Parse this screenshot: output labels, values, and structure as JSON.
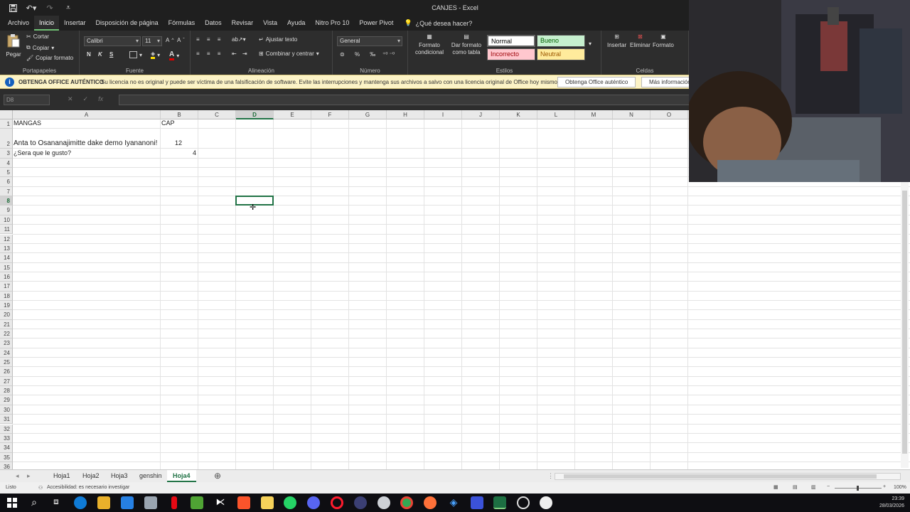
{
  "window": {
    "title": "CANJES - Excel"
  },
  "menu": {
    "tabs": [
      "Archivo",
      "Inicio",
      "Insertar",
      "Disposición de página",
      "Fórmulas",
      "Datos",
      "Revisar",
      "Vista",
      "Ayuda",
      "Nitro Pro 10",
      "Power Pivot"
    ],
    "tell_me": "¿Qué desea hacer?"
  },
  "ribbon": {
    "clipboard": {
      "paste": "Pegar",
      "cut": "Cortar",
      "copy": "Copiar",
      "format_painter": "Copiar formato",
      "label": "Portapapeles"
    },
    "font": {
      "name": "Calibri",
      "size": "11",
      "bold": "N",
      "italic": "K",
      "underline": "S",
      "label": "Fuente"
    },
    "alignment": {
      "wrap": "Ajustar texto",
      "merge": "Combinar y centrar",
      "label": "Alineación"
    },
    "number": {
      "format": "General",
      "label": "Número"
    },
    "styles": {
      "conditional": "Formato condicional",
      "as_table": "Dar formato como tabla",
      "normal": "Normal",
      "bueno": "Bueno",
      "incorrecto": "Incorrecto",
      "neutral": "Neutral",
      "label": "Estilos"
    },
    "cells": {
      "insert": "Insertar",
      "delete": "Eliminar",
      "format": "Formato",
      "label": "Celdas"
    }
  },
  "warning": {
    "title": "OBTENGA OFFICE AUTÉNTICO",
    "message": "Su licencia no es original y puede ser víctima de una falsificación de software. Evite las interrupciones y mantenga sus archivos a salvo con una licencia original de Office hoy mismo.",
    "button_primary": "Obtenga Office auténtico",
    "button_more": "Más información"
  },
  "formula_bar": {
    "name_box": "D8",
    "fx": "fx",
    "value": ""
  },
  "sheet": {
    "columns": [
      "A",
      "B",
      "C",
      "D",
      "E",
      "F",
      "G",
      "H",
      "I",
      "J",
      "K",
      "L",
      "M",
      "N",
      "O"
    ],
    "rows": [
      "1",
      "2",
      "3",
      "4",
      "5",
      "6",
      "7",
      "8",
      "9",
      "10",
      "11",
      "12",
      "13",
      "14",
      "15",
      "16",
      "17",
      "18",
      "19",
      "20",
      "21",
      "22",
      "23",
      "24",
      "25",
      "26",
      "27",
      "28",
      "29",
      "30",
      "31",
      "32",
      "33",
      "34",
      "35",
      "36"
    ],
    "cells": {
      "A1": "MANGAS",
      "B1": "CAP",
      "A2": "Anta to Osananajimitte dake demo Iyananoni!",
      "B2": "12",
      "A3": "¿Sera que le gusto?",
      "B3": "4"
    },
    "selected_cell": "D8"
  },
  "tabs": [
    "Hoja1",
    "Hoja2",
    "Hoja3",
    "genshin",
    "Hoja4"
  ],
  "active_tab": "Hoja4",
  "status": {
    "ready": "Listo",
    "accessibility": "Accesibilidad: es necesario investigar",
    "zoom": "100%"
  },
  "clock": {
    "time": "23:39",
    "date": "28/03/2026"
  }
}
